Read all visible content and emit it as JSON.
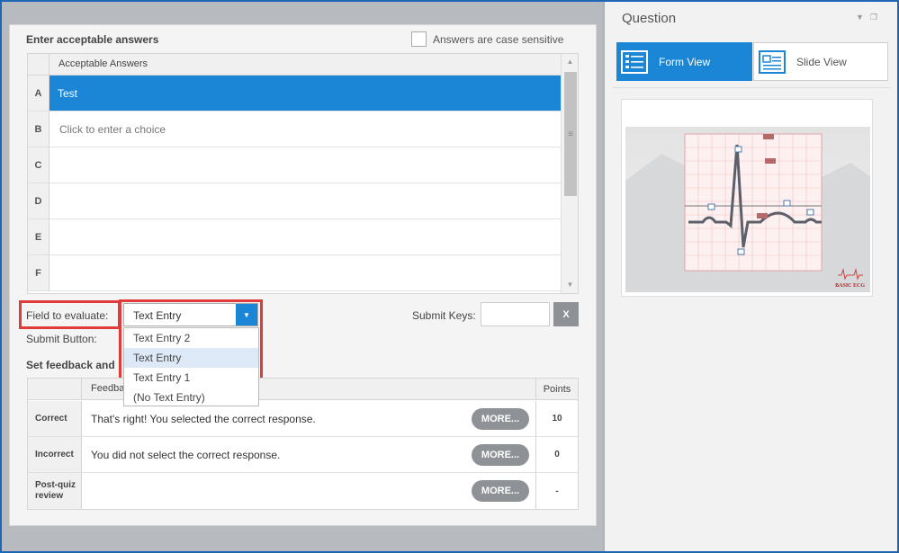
{
  "answers_section": {
    "title": "Enter acceptable answers",
    "case_sensitive_label": "Answers are case sensitive",
    "case_sensitive_checked": false,
    "column_header": "Acceptable Answers",
    "rows": [
      {
        "letter": "A",
        "value": "Test",
        "selected": true
      },
      {
        "letter": "B",
        "placeholder": "Click to enter a choice"
      },
      {
        "letter": "C",
        "value": ""
      },
      {
        "letter": "D",
        "value": ""
      },
      {
        "letter": "E",
        "value": ""
      },
      {
        "letter": "F",
        "value": ""
      }
    ]
  },
  "evaluate": {
    "label": "Field to evaluate:",
    "selected": "Text Entry",
    "options": [
      "Text Entry 2",
      "Text Entry",
      "Text Entry 1",
      "(No Text Entry)"
    ],
    "submit_keys_label": "Submit Keys:",
    "submit_keys_value": "",
    "clear_label": "X",
    "submit_button_label": "Submit Button:"
  },
  "feedback_section": {
    "title": "Set feedback and",
    "column_feedback": "Feedback",
    "column_points": "Points",
    "rows": [
      {
        "label": "Correct",
        "text": "That's right!  You selected the correct response.",
        "more": "MORE...",
        "points": "10"
      },
      {
        "label": "Incorrect",
        "text": "You did not select the correct response.",
        "more": "MORE...",
        "points": "0"
      },
      {
        "label": "Post-quiz review",
        "text": "",
        "more": "MORE...",
        "points": "-"
      }
    ]
  },
  "question_panel": {
    "title": "Question",
    "form_view": "Form View",
    "slide_view": "Slide View",
    "slide_logo_text": "BASIC ECG"
  },
  "colors": {
    "accent": "#1b86d6",
    "highlight_red": "#e03b3b",
    "button_gray": "#8e9296"
  }
}
